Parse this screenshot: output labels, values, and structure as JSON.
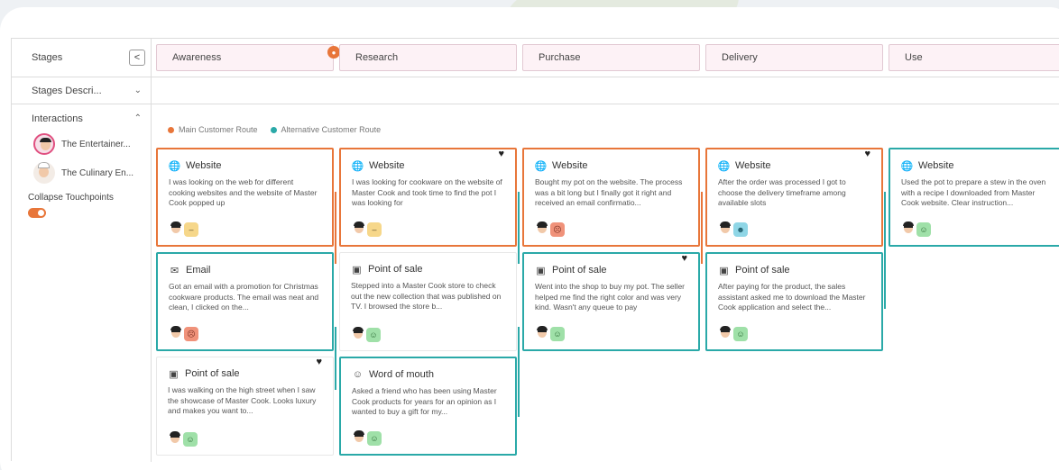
{
  "sidebar": {
    "stages_label": "Stages",
    "collapse_glyph": "<",
    "stages_description_label": "Stages Descri...",
    "interactions_label": "Interactions",
    "personas": [
      {
        "name": "The Entertainer..."
      },
      {
        "name": "The Culinary En..."
      }
    ],
    "collapse_touchpoints_label": "Collapse Touchpoints",
    "collapse_touchpoints_on": true
  },
  "stages": [
    {
      "label": "Awareness"
    },
    {
      "label": "Research"
    },
    {
      "label": "Purchase"
    },
    {
      "label": "Delivery"
    },
    {
      "label": "Use"
    }
  ],
  "legend": {
    "main": "Main Customer Route",
    "alt": "Alternative Customer Route",
    "main_color": "#e8763a",
    "alt_color": "#2aa9a8"
  },
  "cards": [
    {
      "channel": "Website",
      "icon": "globe-icon",
      "route": "main",
      "emotion": "neutral",
      "favorite": false,
      "text": "I was looking on the web for different cooking websites and the website of Master Cook popped up"
    },
    {
      "channel": "Email",
      "icon": "email-icon",
      "route": "alt",
      "emotion": "sad",
      "favorite": false,
      "text": "Got an email with a promotion for Christmas cookware products. The email was neat and clean, I clicked on the..."
    },
    {
      "channel": "Point of sale",
      "icon": "store-icon",
      "route": "plain",
      "emotion": "happy",
      "favorite": true,
      "text": "I was walking on the high street when I saw the showcase of Master Cook. Looks luxury and makes you want to..."
    },
    {
      "channel": "Website",
      "icon": "globe-icon",
      "route": "main",
      "emotion": "neutral",
      "favorite": true,
      "text": "I was looking for cookware on the website of Master Cook and took time to find the pot I was looking for"
    },
    {
      "channel": "Point of sale",
      "icon": "store-icon",
      "route": "plain",
      "emotion": "happy",
      "favorite": false,
      "text": "Stepped into a Master Cook store to check out the new collection that was published on TV. I browsed the store b..."
    },
    {
      "channel": "Word of mouth",
      "icon": "word-of-mouth-icon",
      "route": "alt",
      "emotion": "happy",
      "favorite": false,
      "text": "Asked a friend who has been using Master Cook products for years for an opinion as I wanted to buy a gift for my..."
    },
    {
      "channel": "Website",
      "icon": "globe-icon",
      "route": "main",
      "emotion": "sad",
      "favorite": false,
      "text": "Bought my pot on the website. The process was a bit long but I finally got it right and received an email confirmatio..."
    },
    {
      "channel": "Point of sale",
      "icon": "store-icon",
      "route": "alt",
      "emotion": "happy",
      "favorite": true,
      "text": "Went into the shop to buy my pot. The seller helped me find the right color and was very kind. Wasn't any queue to pay"
    },
    {
      "channel": "Website",
      "icon": "globe-icon",
      "route": "main",
      "emotion": "delight",
      "favorite": true,
      "text": "After the order was processed I got to choose the delivery timeframe among available slots"
    },
    {
      "channel": "Point of sale",
      "icon": "store-icon",
      "route": "alt",
      "emotion": "happy",
      "favorite": false,
      "text": "After paying for the product, the sales assistant asked me to download the Master Cook application and select the..."
    },
    {
      "channel": "Website",
      "icon": "globe-icon",
      "route": "alt",
      "emotion": "happy",
      "favorite": false,
      "text": "Used the pot to prepare a stew in the oven with a recipe I downloaded from Master Cook website. Clear instruction..."
    }
  ]
}
